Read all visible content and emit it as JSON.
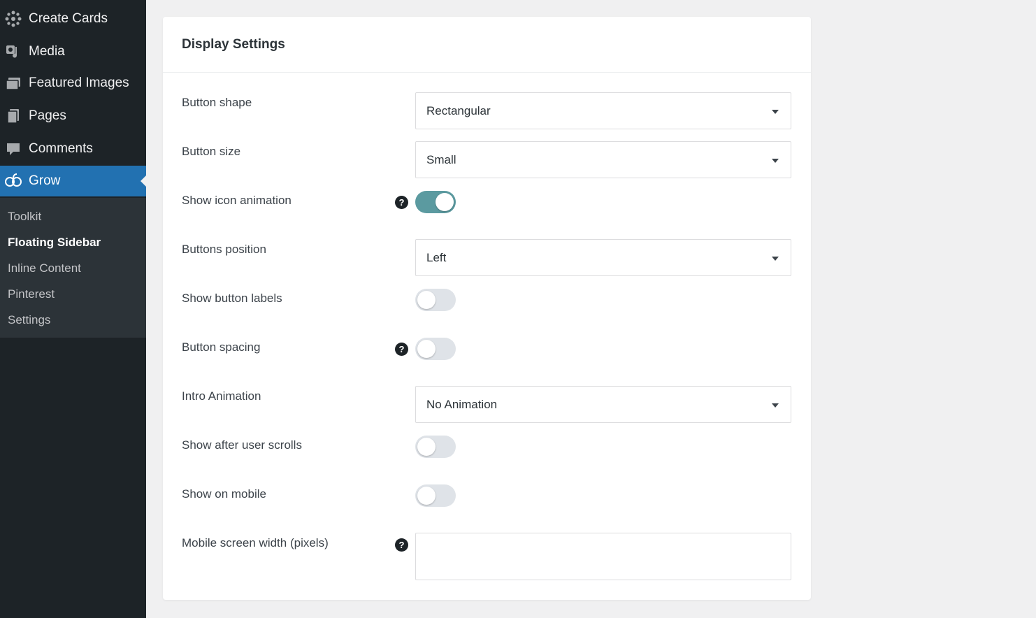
{
  "sidebar": {
    "menu": [
      {
        "label": "Create Cards",
        "icon": "gear-burst-icon"
      },
      {
        "label": "Media",
        "icon": "media-icon"
      },
      {
        "label": "Featured Images",
        "icon": "images-icon"
      },
      {
        "label": "Pages",
        "icon": "pages-icon"
      },
      {
        "label": "Comments",
        "icon": "comment-icon"
      },
      {
        "label": "Grow",
        "icon": "grow-icon",
        "active": true
      }
    ],
    "submenu": [
      {
        "label": "Toolkit"
      },
      {
        "label": "Floating Sidebar",
        "current": true
      },
      {
        "label": "Inline Content"
      },
      {
        "label": "Pinterest"
      },
      {
        "label": "Settings"
      }
    ]
  },
  "panel": {
    "title": "Display Settings",
    "rows": [
      {
        "label": "Button shape",
        "type": "select",
        "value": "Rectangular"
      },
      {
        "label": "Button size",
        "type": "select",
        "value": "Small"
      },
      {
        "label": "Show icon animation",
        "type": "toggle",
        "on": true,
        "help": true
      },
      {
        "label": "Buttons position",
        "type": "select",
        "value": "Left"
      },
      {
        "label": "Show button labels",
        "type": "toggle",
        "on": false
      },
      {
        "label": "Button spacing",
        "type": "toggle",
        "on": false,
        "help": true
      },
      {
        "label": "Intro Animation",
        "type": "select",
        "value": "No Animation"
      },
      {
        "label": "Show after user scrolls",
        "type": "toggle",
        "on": false
      },
      {
        "label": "Show on mobile",
        "type": "toggle",
        "on": false
      },
      {
        "label": "Mobile screen width (pixels)",
        "type": "text",
        "value": "",
        "help": true
      }
    ],
    "help_glyph": "?"
  },
  "colors": {
    "sidebar_bg": "#1d2327",
    "active_bg": "#2271b1",
    "toggle_on": "#5b9aa0",
    "toggle_off": "#dfe3e8"
  }
}
